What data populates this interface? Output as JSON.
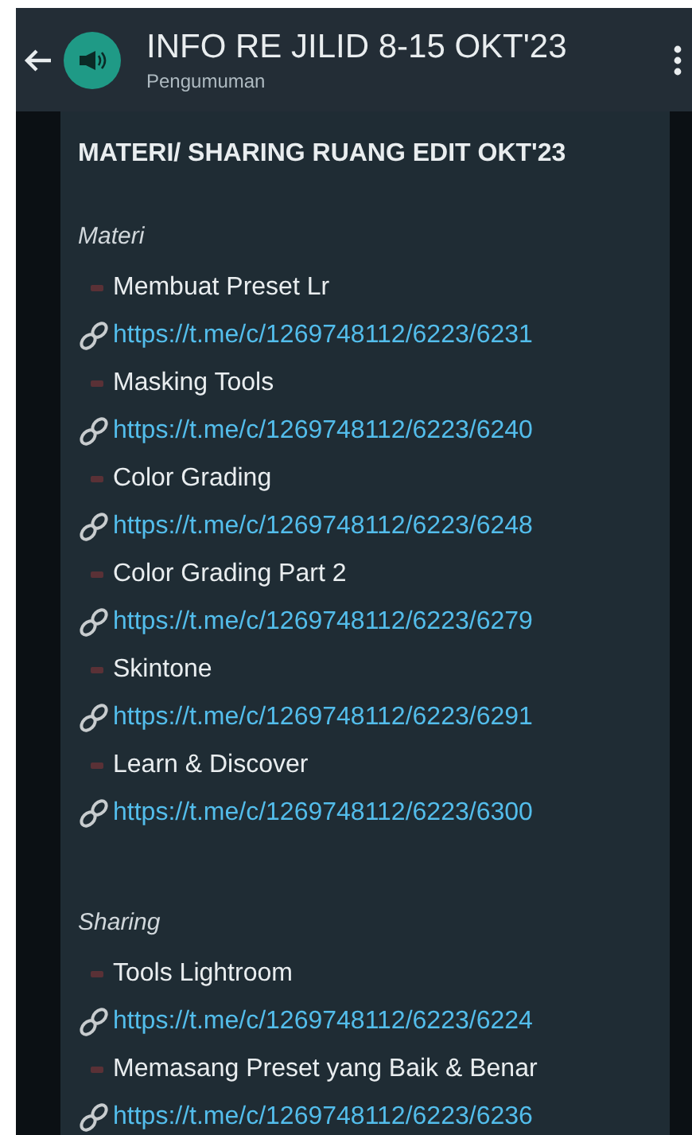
{
  "header": {
    "title": "INFO RE JILID 8-15 OKT'23",
    "subtitle": "Pengumuman"
  },
  "message": {
    "title": "MATERI/ SHARING RUANG EDIT OKT'23",
    "sections": [
      {
        "heading": "Materi",
        "items": [
          {
            "label": "Membuat Preset Lr",
            "url": "https://t.me/c/1269748112/6223/6231"
          },
          {
            "label": "Masking Tools",
            "url": "https://t.me/c/1269748112/6223/6240"
          },
          {
            "label": "Color Grading",
            "url": "https://t.me/c/1269748112/6223/6248"
          },
          {
            "label": "Color Grading Part 2",
            "url": "https://t.me/c/1269748112/6223/6279"
          },
          {
            "label": "Skintone",
            "url": "https://t.me/c/1269748112/6223/6291"
          },
          {
            "label": "Learn & Discover",
            "url": "https://t.me/c/1269748112/6223/6300"
          }
        ]
      },
      {
        "heading": "Sharing",
        "items": [
          {
            "label": "Tools Lightroom",
            "url": "https://t.me/c/1269748112/6223/6224"
          },
          {
            "label": "Memasang Preset yang Baik & Benar",
            "url": "https://t.me/c/1269748112/6223/6236"
          }
        ]
      }
    ]
  }
}
